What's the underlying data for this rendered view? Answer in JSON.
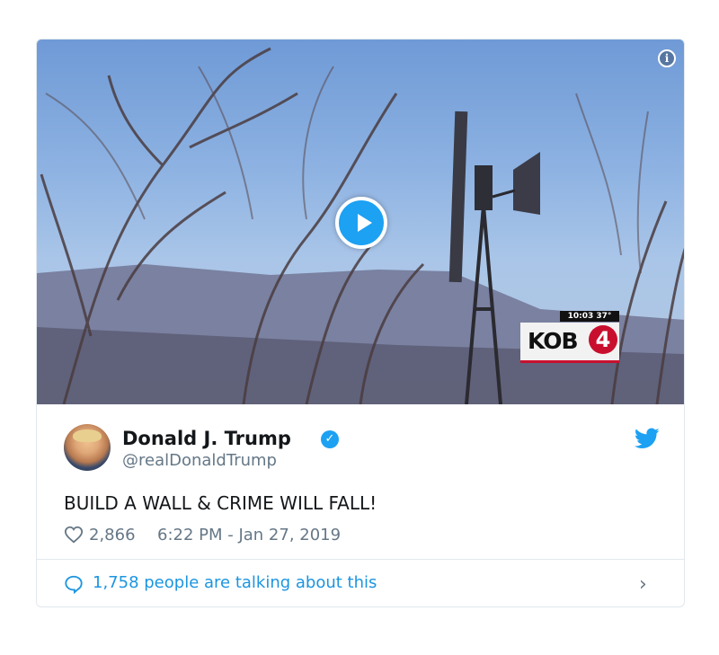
{
  "media": {
    "info_glyph": "i",
    "icons": {
      "play": "play-icon",
      "info": "info-icon"
    },
    "broadcaster": {
      "name": "KOB",
      "channel": "4",
      "ticker": "10:03  37°",
      "accent_color": "#c8102e"
    }
  },
  "tweet": {
    "display_name": "Donald J. Trump",
    "verified_glyph": "✓",
    "handle": "@realDonaldTrump",
    "text": "BUILD A WALL & CRIME WILL FALL!",
    "likes": "2,866",
    "timestamp": "6:22 PM - Jan 27, 2019",
    "icons": {
      "verified": "verified-badge-icon",
      "brand": "twitter-bird-icon",
      "like": "heart-icon"
    }
  },
  "footer": {
    "talking_label": "1,758 people are talking about this",
    "chevron": "›",
    "icons": {
      "reply": "speech-bubble-icon",
      "arrow": "chevron-right-icon"
    }
  },
  "colors": {
    "brand_blue": "#1da1f2",
    "link_blue": "#1b95e0",
    "secondary_text": "#657786",
    "primary_text": "#14171a",
    "border": "#e1e8ed"
  }
}
